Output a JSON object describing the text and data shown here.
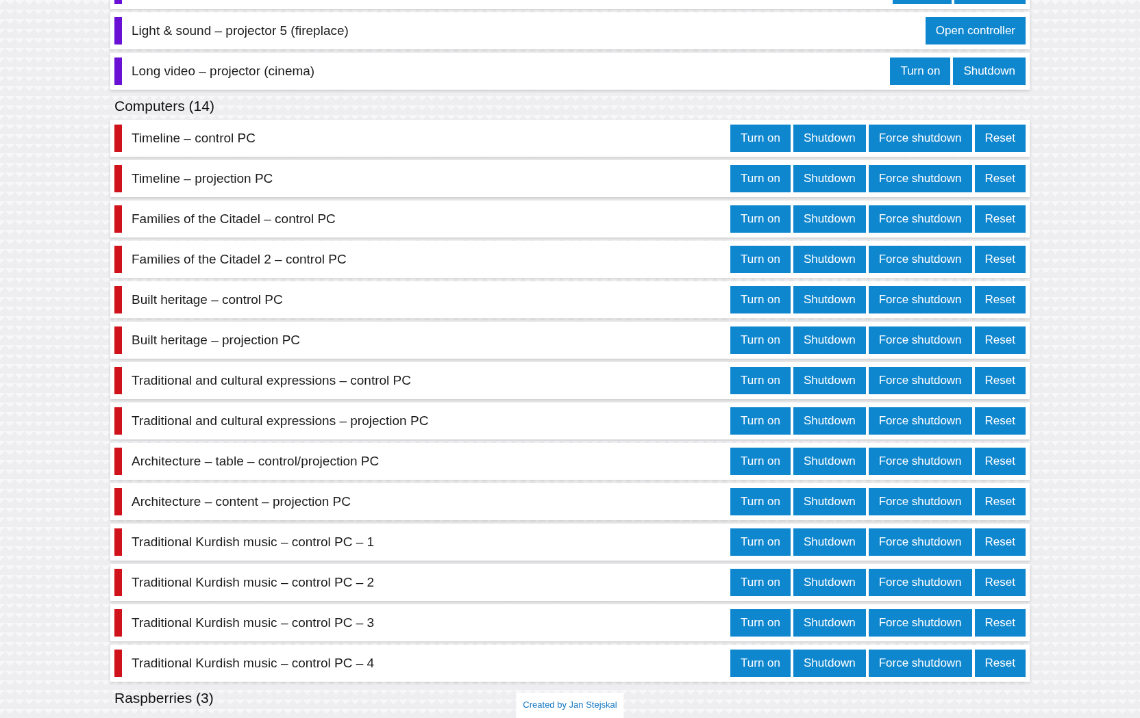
{
  "sections": [
    {
      "rows": [
        {
          "color": "#6a10d4",
          "buttons": [
            {
              "kind": "blank"
            },
            {
              "kind": "blank"
            }
          ]
        },
        {
          "name": "Light & sound – projector 5 (fireplace)",
          "color": "#6a10d4",
          "buttons": [
            {
              "kind": "labeled",
              "label": "Open controller"
            }
          ]
        },
        {
          "name": "Long video – projector (cinema)",
          "color": "#6a10d4",
          "buttons": [
            {
              "kind": "labeled",
              "label": "Turn on"
            },
            {
              "kind": "labeled",
              "label": "Shutdown"
            }
          ]
        }
      ]
    },
    {
      "title": "Computers (14)",
      "rows": [
        {
          "name": "Timeline – control PC",
          "color": "#d0121a",
          "buttons": [
            {
              "kind": "labeled",
              "label": "Turn on"
            },
            {
              "kind": "labeled",
              "label": "Shutdown"
            },
            {
              "kind": "labeled",
              "label": "Force shutdown"
            },
            {
              "kind": "labeled",
              "label": "Reset"
            }
          ]
        },
        {
          "name": "Timeline – projection PC",
          "color": "#d0121a",
          "buttons": [
            {
              "kind": "labeled",
              "label": "Turn on"
            },
            {
              "kind": "labeled",
              "label": "Shutdown"
            },
            {
              "kind": "labeled",
              "label": "Force shutdown"
            },
            {
              "kind": "labeled",
              "label": "Reset"
            }
          ]
        },
        {
          "name": "Families of the Citadel – control PC",
          "color": "#d0121a",
          "buttons": [
            {
              "kind": "labeled",
              "label": "Turn on"
            },
            {
              "kind": "labeled",
              "label": "Shutdown"
            },
            {
              "kind": "labeled",
              "label": "Force shutdown"
            },
            {
              "kind": "labeled",
              "label": "Reset"
            }
          ]
        },
        {
          "name": "Families of the Citadel 2 – control PC",
          "color": "#d0121a",
          "buttons": [
            {
              "kind": "labeled",
              "label": "Turn on"
            },
            {
              "kind": "labeled",
              "label": "Shutdown"
            },
            {
              "kind": "labeled",
              "label": "Force shutdown"
            },
            {
              "kind": "labeled",
              "label": "Reset"
            }
          ]
        },
        {
          "name": "Built heritage – control PC",
          "color": "#d0121a",
          "buttons": [
            {
              "kind": "labeled",
              "label": "Turn on"
            },
            {
              "kind": "labeled",
              "label": "Shutdown"
            },
            {
              "kind": "labeled",
              "label": "Force shutdown"
            },
            {
              "kind": "labeled",
              "label": "Reset"
            }
          ]
        },
        {
          "name": "Built heritage – projection PC",
          "color": "#d0121a",
          "buttons": [
            {
              "kind": "labeled",
              "label": "Turn on"
            },
            {
              "kind": "labeled",
              "label": "Shutdown"
            },
            {
              "kind": "labeled",
              "label": "Force shutdown"
            },
            {
              "kind": "labeled",
              "label": "Reset"
            }
          ]
        },
        {
          "name": "Traditional and cultural expressions – control PC",
          "color": "#d0121a",
          "buttons": [
            {
              "kind": "labeled",
              "label": "Turn on"
            },
            {
              "kind": "labeled",
              "label": "Shutdown"
            },
            {
              "kind": "labeled",
              "label": "Force shutdown"
            },
            {
              "kind": "labeled",
              "label": "Reset"
            }
          ]
        },
        {
          "name": "Traditional and cultural expressions – projection PC",
          "color": "#d0121a",
          "buttons": [
            {
              "kind": "labeled",
              "label": "Turn on"
            },
            {
              "kind": "labeled",
              "label": "Shutdown"
            },
            {
              "kind": "labeled",
              "label": "Force shutdown"
            },
            {
              "kind": "labeled",
              "label": "Reset"
            }
          ]
        },
        {
          "name": "Architecture – table – control/projection PC",
          "color": "#d0121a",
          "buttons": [
            {
              "kind": "labeled",
              "label": "Turn on"
            },
            {
              "kind": "labeled",
              "label": "Shutdown"
            },
            {
              "kind": "labeled",
              "label": "Force shutdown"
            },
            {
              "kind": "labeled",
              "label": "Reset"
            }
          ]
        },
        {
          "name": "Architecture – content – projection PC",
          "color": "#d0121a",
          "buttons": [
            {
              "kind": "labeled",
              "label": "Turn on"
            },
            {
              "kind": "labeled",
              "label": "Shutdown"
            },
            {
              "kind": "labeled",
              "label": "Force shutdown"
            },
            {
              "kind": "labeled",
              "label": "Reset"
            }
          ]
        },
        {
          "name": "Traditional Kurdish music – control PC – 1",
          "color": "#d0121a",
          "buttons": [
            {
              "kind": "labeled",
              "label": "Turn on"
            },
            {
              "kind": "labeled",
              "label": "Shutdown"
            },
            {
              "kind": "labeled",
              "label": "Force shutdown"
            },
            {
              "kind": "labeled",
              "label": "Reset"
            }
          ]
        },
        {
          "name": "Traditional Kurdish music – control PC – 2",
          "color": "#d0121a",
          "buttons": [
            {
              "kind": "labeled",
              "label": "Turn on"
            },
            {
              "kind": "labeled",
              "label": "Shutdown"
            },
            {
              "kind": "labeled",
              "label": "Force shutdown"
            },
            {
              "kind": "labeled",
              "label": "Reset"
            }
          ]
        },
        {
          "name": "Traditional Kurdish music – control PC – 3",
          "color": "#d0121a",
          "buttons": [
            {
              "kind": "labeled",
              "label": "Turn on"
            },
            {
              "kind": "labeled",
              "label": "Shutdown"
            },
            {
              "kind": "labeled",
              "label": "Force shutdown"
            },
            {
              "kind": "labeled",
              "label": "Reset"
            }
          ]
        },
        {
          "name": "Traditional Kurdish music – control PC – 4",
          "color": "#d0121a",
          "buttons": [
            {
              "kind": "labeled",
              "label": "Turn on"
            },
            {
              "kind": "labeled",
              "label": "Shutdown"
            },
            {
              "kind": "labeled",
              "label": "Force shutdown"
            },
            {
              "kind": "labeled",
              "label": "Reset"
            }
          ]
        }
      ]
    },
    {
      "title": "Raspberries (3)"
    }
  ],
  "footer": {
    "text": "Created by ",
    "link": "Jan Stejskal"
  }
}
